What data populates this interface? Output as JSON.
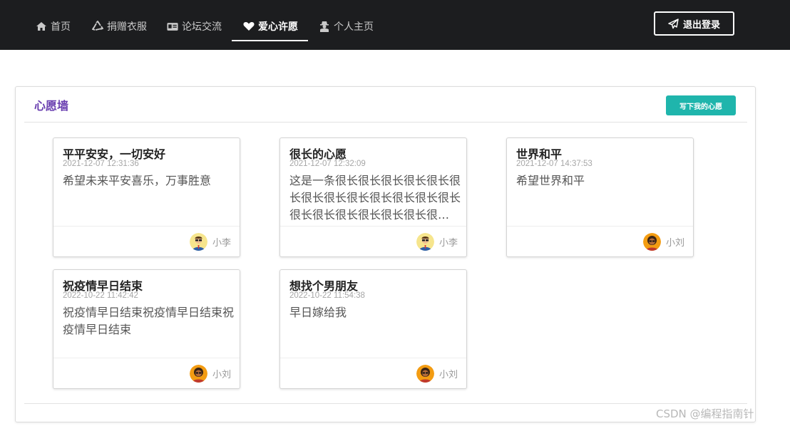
{
  "nav": {
    "items": [
      {
        "label": "首页",
        "icon": "home-icon"
      },
      {
        "label": "捐赠衣服",
        "icon": "recycle-icon"
      },
      {
        "label": "论坛交流",
        "icon": "id-card-icon"
      },
      {
        "label": "爱心许愿",
        "icon": "heart-icon",
        "active": true
      },
      {
        "label": "个人主页",
        "icon": "user-secret-icon"
      }
    ],
    "logout_label": "退出登录"
  },
  "panel": {
    "title": "心愿墙",
    "write_label": "写下我的心愿"
  },
  "cards": [
    {
      "title": "平平安安，一切安好",
      "time": "2021-12-07 12:31:36",
      "content": "希望未来平安喜乐，万事胜意",
      "author": "小李",
      "avatar": "avatar-glasses"
    },
    {
      "title": "很长的心愿",
      "time": "2021-12-07 12:32:09",
      "content": "这是一条很长很长很长很长很长很长很长很长很长很长很长很长很长很长很长很长很长很长很长很长很长很长很长很长",
      "author": "小李",
      "avatar": "avatar-glasses"
    },
    {
      "title": "世界和平",
      "time": "2021-12-07 14:37:53",
      "content": "希望世界和平",
      "author": "小刘",
      "avatar": "avatar-afro"
    },
    {
      "title": "祝疫情早日结束",
      "time": "2022-10-22 11:42:42",
      "content": "祝疫情早日结束祝疫情早日结束祝疫情早日结束",
      "author": "小刘",
      "avatar": "avatar-afro"
    },
    {
      "title": "想找个男朋友",
      "time": "2022-10-22 11:54:38",
      "content": "早日嫁给我",
      "author": "小刘",
      "avatar": "avatar-afro"
    }
  ],
  "watermark": "CSDN @编程指南针",
  "colors": {
    "navbar": "#1c1d1f",
    "accent_button": "#1fb5ac",
    "title_purple": "#6a3fb0"
  }
}
